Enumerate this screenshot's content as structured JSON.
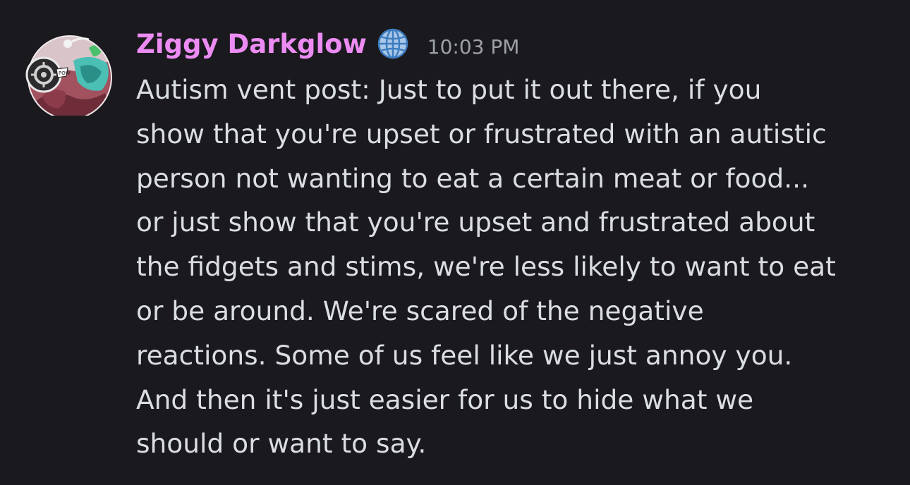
{
  "message": {
    "author": "Ziggy Darkglow",
    "timestamp": "10:03 PM",
    "avatar_icon": "character-avatar",
    "badge_icon": "globe-icon",
    "content_lines": [
      "Autism vent post: Just to put it out there, if you",
      "show that you're upset or frustrated with an autistic",
      "person not wanting to eat a certain meat or food...",
      "or just show that you're upset and frustrated about",
      "the fidgets and stims, we're less likely to want to eat",
      "or be around. We're scared of the negative",
      "reactions. Some of us feel like we just annoy you.",
      "And then it's just easier for us to hide what we",
      "should or want to say."
    ]
  },
  "colors": {
    "background": "#1a1a1e",
    "username": "#ec8cf3",
    "text": "#dbdee1",
    "timestamp": "#9ca0a6"
  }
}
